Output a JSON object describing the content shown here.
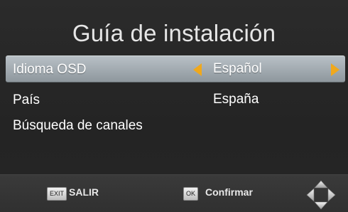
{
  "title": "Guía de instalación",
  "menu": {
    "rows": [
      {
        "label": "Idioma OSD",
        "value": "Español",
        "selected": true
      },
      {
        "label": "País",
        "value": "España",
        "selected": false
      },
      {
        "label": "Búsqueda de canales",
        "value": "",
        "selected": false
      }
    ]
  },
  "footer": {
    "exit_key": "EXIT",
    "exit_label": "SALIR",
    "ok_key": "OK",
    "ok_label": "Confirmar"
  },
  "icons": {
    "option_arrows": "orange-triangle-arrows",
    "navigation": "dpad-arrows-icon"
  },
  "colors": {
    "selection_bar": "#a3abb1",
    "arrow_accent": "#f0a81c",
    "text": "#ffffff",
    "background": "#262626"
  }
}
